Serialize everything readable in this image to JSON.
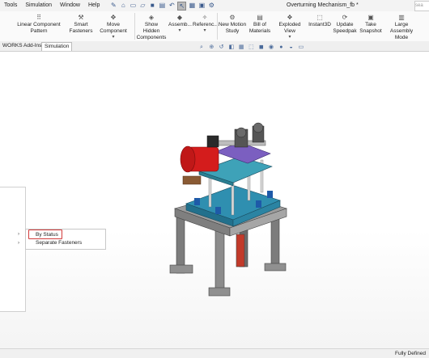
{
  "menubar": {
    "items": [
      "Tools",
      "Simulation",
      "Window",
      "Help"
    ],
    "document_title": "Overturning Mechanism_fb *",
    "search_hint": "sea"
  },
  "ribbon": {
    "buttons": [
      {
        "label": "Linear Component Pattern",
        "icon": "pattern-icon"
      },
      {
        "label": "Smart Fasteners",
        "icon": "fastener-icon"
      },
      {
        "label": "Move Component",
        "icon": "move-icon"
      },
      {
        "label": "Show Hidden Components",
        "icon": "show-hidden-icon"
      },
      {
        "label": "Assemb...",
        "icon": "assembly-icon"
      },
      {
        "label": "Referenc...",
        "icon": "reference-icon"
      },
      {
        "label": "New Motion Study",
        "icon": "motion-study-icon"
      },
      {
        "label": "Bill of Materials",
        "icon": "bom-icon"
      },
      {
        "label": "Exploded View",
        "icon": "exploded-view-icon"
      },
      {
        "label": "Instant3D",
        "icon": "instant3d-icon"
      },
      {
        "label": "Update Speedpak",
        "icon": "speedpak-icon"
      },
      {
        "label": "Take Snapshot",
        "icon": "snapshot-icon"
      },
      {
        "label": "Large Assembly Mode",
        "icon": "large-assembly-icon"
      }
    ]
  },
  "tabs": [
    "WORKS Add-Ins",
    "Simulation"
  ],
  "context_menu": {
    "items": [
      "By Status",
      "Separate Fasteners"
    ]
  },
  "status_bar": {
    "text": "Fully Defined"
  },
  "colors": {
    "highlight": "#d23b3b",
    "motor": "#d41c1c",
    "plate_blue": "#2f8fb0",
    "frame_gray": "#8f8f8f"
  }
}
